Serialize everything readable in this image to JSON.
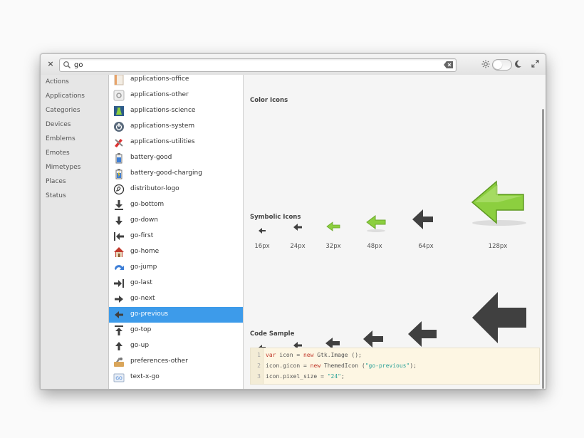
{
  "window": {
    "close_label": "×",
    "search_value": "go",
    "colors": {
      "selection": "#3d9bea",
      "gtk_green": "#8ccf3f",
      "symbolic": "#404040"
    }
  },
  "sidebar": {
    "categories": [
      {
        "label": "Actions"
      },
      {
        "label": "Applications"
      },
      {
        "label": "Categories"
      },
      {
        "label": "Devices"
      },
      {
        "label": "Emblems"
      },
      {
        "label": "Emotes"
      },
      {
        "label": "Mimetypes"
      },
      {
        "label": "Places"
      },
      {
        "label": "Status"
      }
    ]
  },
  "icon_list": {
    "items": [
      {
        "label": "applications-office",
        "icon": "office-icon"
      },
      {
        "label": "applications-other",
        "icon": "other-icon"
      },
      {
        "label": "applications-science",
        "icon": "science-icon"
      },
      {
        "label": "applications-system",
        "icon": "system-icon"
      },
      {
        "label": "applications-utilities",
        "icon": "utilities-icon"
      },
      {
        "label": "battery-good",
        "icon": "battery-icon"
      },
      {
        "label": "battery-good-charging",
        "icon": "battery-charging-icon"
      },
      {
        "label": "distributor-logo",
        "icon": "distributor-logo-icon"
      },
      {
        "label": "go-bottom",
        "icon": "go-bottom-icon"
      },
      {
        "label": "go-down",
        "icon": "go-down-icon"
      },
      {
        "label": "go-first",
        "icon": "go-first-icon"
      },
      {
        "label": "go-home",
        "icon": "go-home-icon"
      },
      {
        "label": "go-jump",
        "icon": "go-jump-icon"
      },
      {
        "label": "go-last",
        "icon": "go-last-icon"
      },
      {
        "label": "go-next",
        "icon": "go-next-icon"
      },
      {
        "label": "go-previous",
        "icon": "go-previous-icon",
        "selected": true
      },
      {
        "label": "go-top",
        "icon": "go-top-icon"
      },
      {
        "label": "go-up",
        "icon": "go-up-icon"
      },
      {
        "label": "preferences-other",
        "icon": "preferences-icon"
      },
      {
        "label": "text-x-go",
        "icon": "text-x-go-icon"
      }
    ]
  },
  "detail": {
    "color_icons_title": "Color Icons",
    "symbolic_icons_title": "Symbolic Icons",
    "code_sample_title": "Code Sample",
    "sizes": [
      "16px",
      "24px",
      "32px",
      "48px",
      "64px",
      "128px"
    ],
    "code_lines": [
      {
        "num": "1",
        "parts": [
          {
            "t": "var",
            "k": "kw"
          },
          {
            "t": " icon = "
          },
          {
            "t": "new",
            "k": "kw"
          },
          {
            "t": " Gtk.Image ();"
          }
        ]
      },
      {
        "num": "2",
        "parts": [
          {
            "t": "icon.gicon = "
          },
          {
            "t": "new",
            "k": "kw"
          },
          {
            "t": " ThemedIcon ("
          },
          {
            "t": "\"go-previous\"",
            "k": "str"
          },
          {
            "t": ");"
          }
        ]
      },
      {
        "num": "3",
        "parts": [
          {
            "t": "icon.pixel_size = "
          },
          {
            "t": "\"24\"",
            "k": "str"
          },
          {
            "t": ";"
          }
        ]
      }
    ]
  }
}
